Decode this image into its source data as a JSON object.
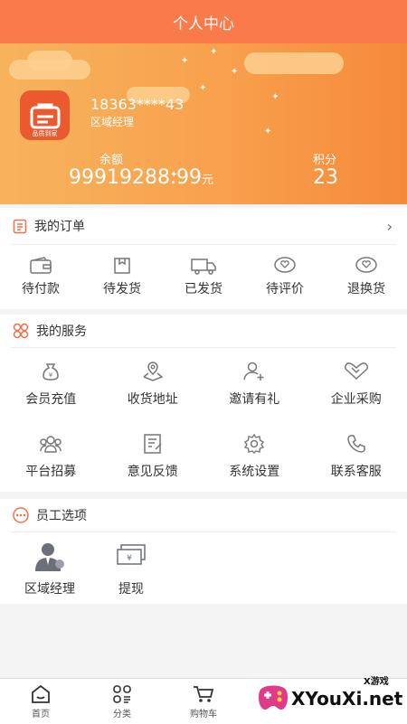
{
  "header": {
    "title": "个人中心"
  },
  "profile": {
    "logo_text": "品质到家",
    "phone": "18363****43",
    "role": "区域经理",
    "balance_label": "余额",
    "balance_value": "99919288.99",
    "balance_unit": "元",
    "points_label": "积分",
    "points_value": "23"
  },
  "orders": {
    "title": "我的订单",
    "items": [
      {
        "label": "待付款",
        "icon": "wallet-icon"
      },
      {
        "label": "待发货",
        "icon": "box-icon"
      },
      {
        "label": "已发货",
        "icon": "truck-icon"
      },
      {
        "label": "待评价",
        "icon": "heart-chat-icon"
      },
      {
        "label": "退换货",
        "icon": "heart-chat-icon"
      }
    ]
  },
  "services": {
    "title": "我的服务",
    "items": [
      {
        "label": "会员充值",
        "icon": "money-bag-icon"
      },
      {
        "label": "收货地址",
        "icon": "map-pin-icon"
      },
      {
        "label": "邀请有礼",
        "icon": "add-user-icon"
      },
      {
        "label": "企业采购",
        "icon": "handshake-icon"
      },
      {
        "label": "平台招募",
        "icon": "group-icon"
      },
      {
        "label": "意见反馈",
        "icon": "feedback-icon"
      },
      {
        "label": "系统设置",
        "icon": "gear-icon"
      },
      {
        "label": "联系客服",
        "icon": "phone-icon"
      }
    ]
  },
  "staff": {
    "title": "员工选项",
    "items": [
      {
        "label": "区域经理",
        "icon": "manager-icon"
      },
      {
        "label": "提现",
        "icon": "cash-icon"
      }
    ]
  },
  "tabbar": {
    "items": [
      {
        "label": "首页",
        "icon": "home-icon"
      },
      {
        "label": "分类",
        "icon": "category-icon"
      },
      {
        "label": "购物车",
        "icon": "cart-icon"
      }
    ]
  },
  "watermark": {
    "text": "XYouXi.net",
    "small": "X游戏"
  },
  "colors": {
    "accent": "#f97a4a",
    "hero_start": "#f7b35c",
    "hero_end": "#f58a3a"
  }
}
